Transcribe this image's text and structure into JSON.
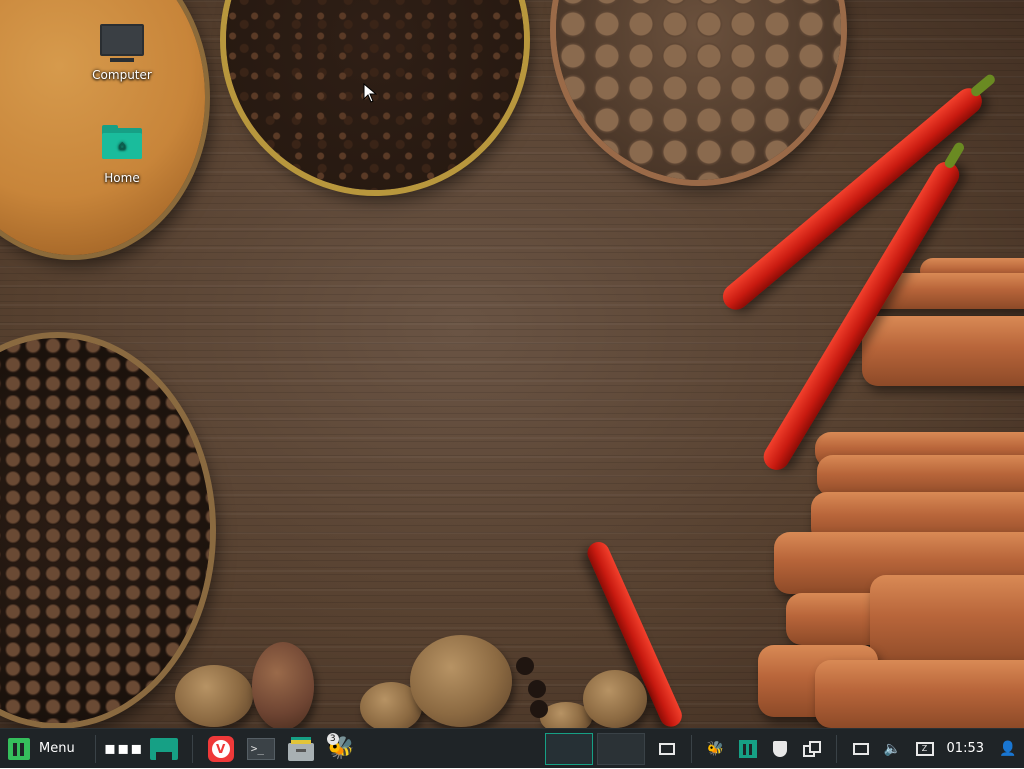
{
  "desktop": {
    "icons": [
      {
        "label": "Computer",
        "icon": "monitor-icon"
      },
      {
        "label": "Home",
        "icon": "home-folder-icon"
      }
    ],
    "wallpaper": "spices-on-wood"
  },
  "taskbar": {
    "menu_label": "Menu",
    "launchers": [
      {
        "icon": "show-apps-dots-icon"
      },
      {
        "icon": "show-desktop-icon"
      },
      {
        "icon": "vivaldi-browser-icon"
      },
      {
        "icon": "terminal-icon",
        "glyph": ">_"
      },
      {
        "icon": "file-manager-icon"
      },
      {
        "icon": "bee-app-icon",
        "badge": "3"
      }
    ],
    "workspaces": [
      {
        "active": true
      },
      {
        "active": false
      }
    ],
    "tray": [
      "window-switcher-icon",
      "bee-tray-icon",
      "mx-package-icon",
      "shield-icon",
      "clipboard-icon",
      "network-icon",
      "volume-icon",
      "keyboard-icon",
      "user-icon"
    ],
    "clock": "01:53"
  },
  "colors": {
    "taskbar_bg": "#1f2427",
    "accent": "#16a085",
    "menu_logo": "#35bf5c",
    "vivaldi": "#ef3939"
  }
}
